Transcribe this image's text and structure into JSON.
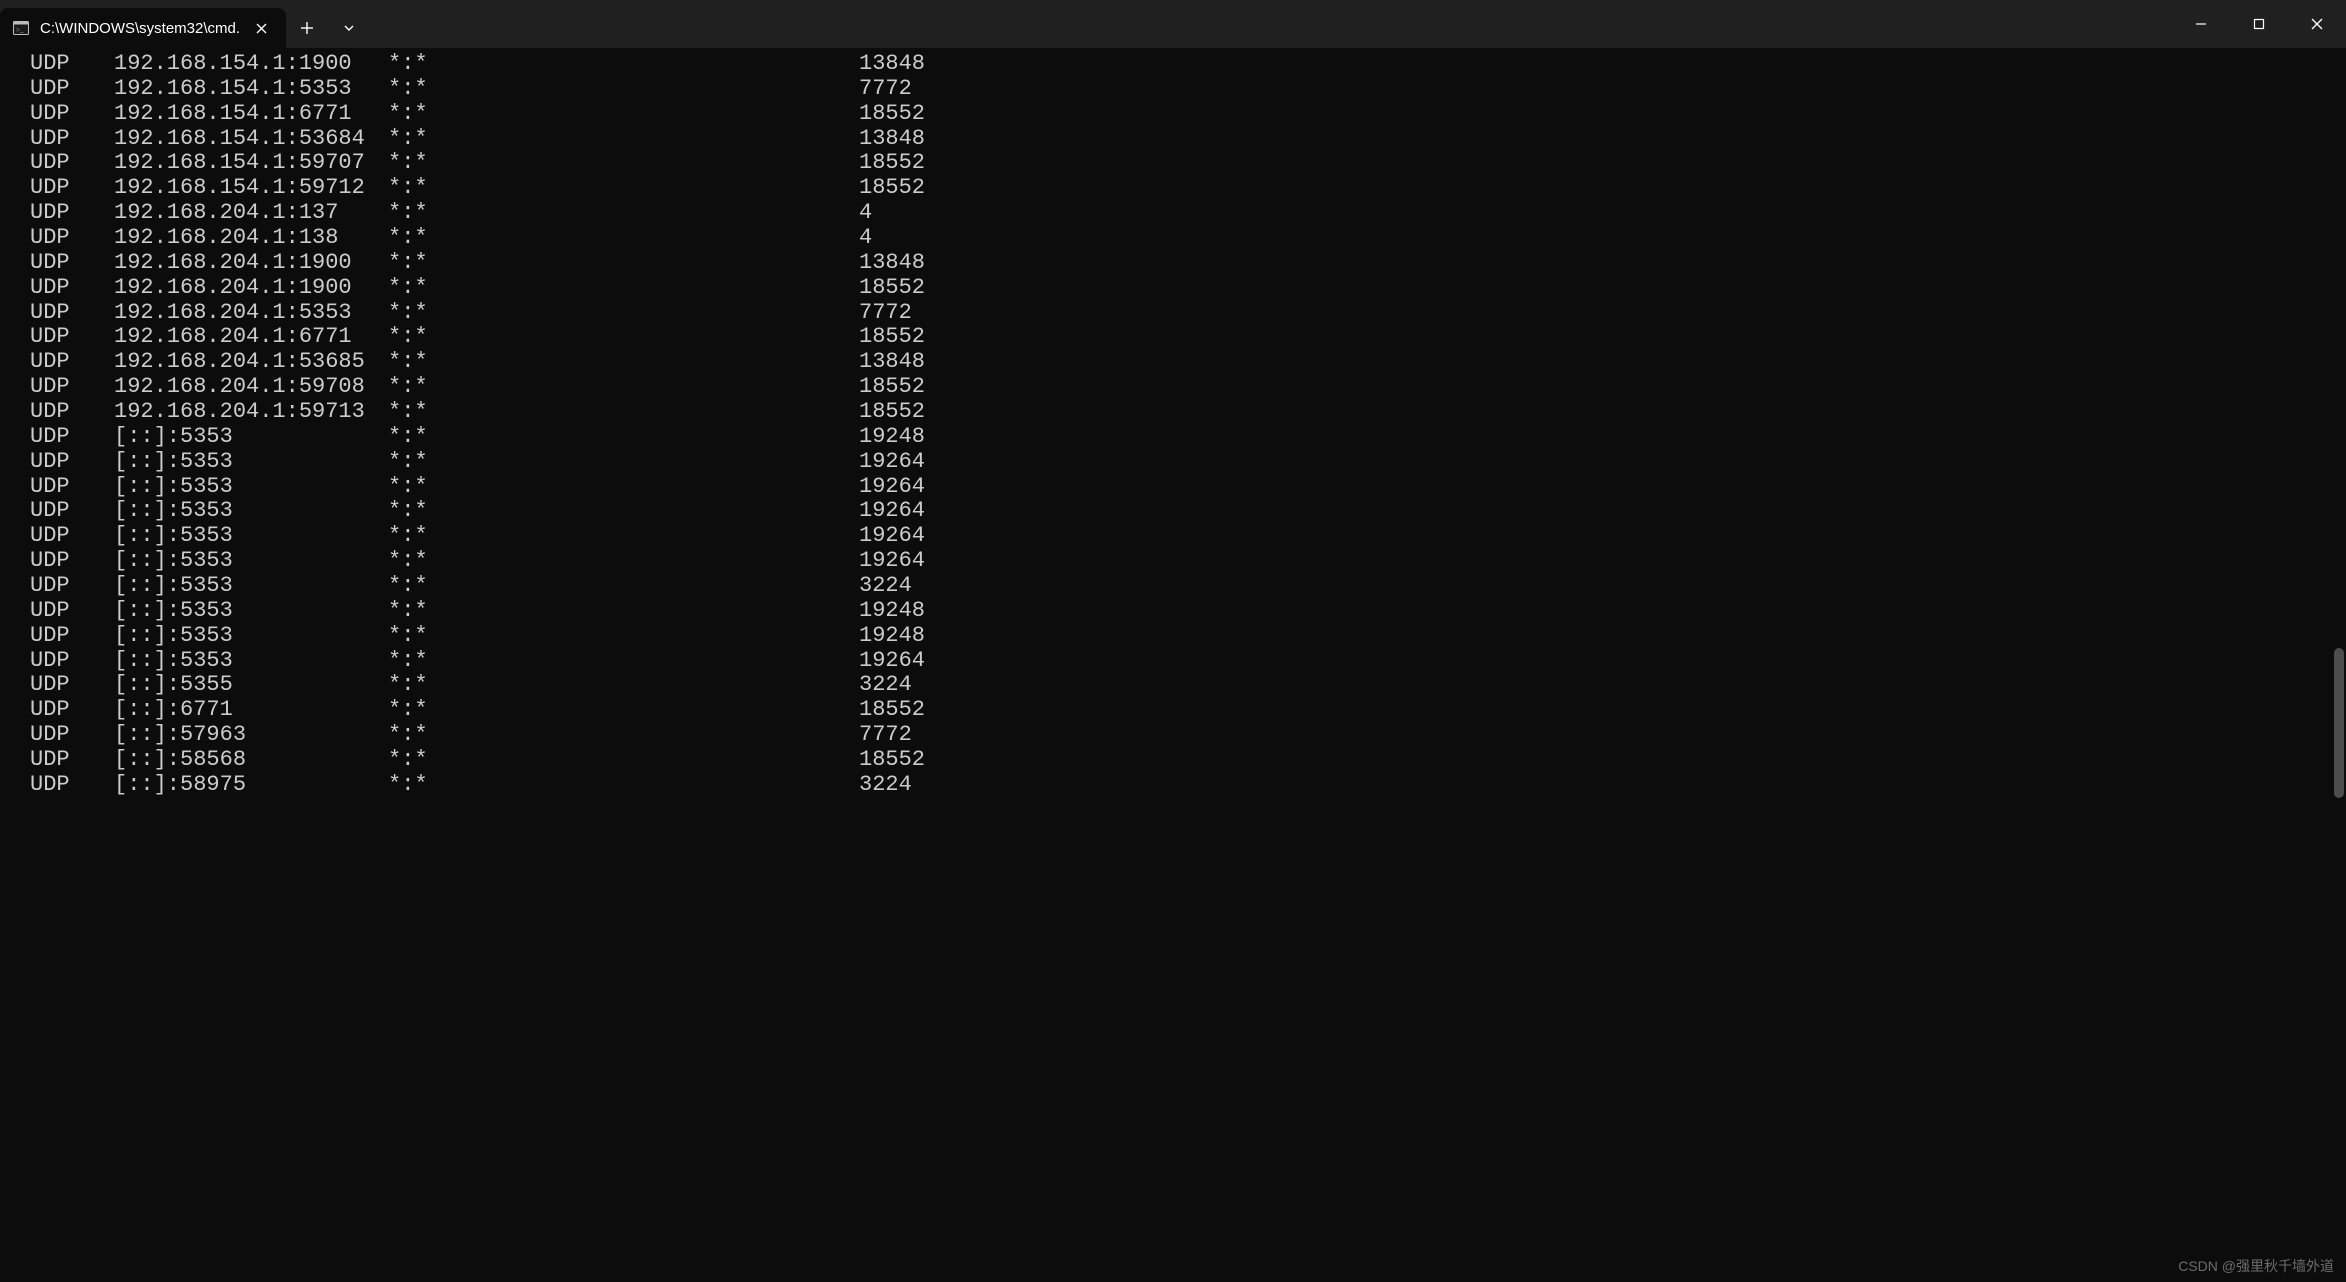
{
  "titlebar": {
    "tab_title": "C:\\WINDOWS\\system32\\cmd."
  },
  "watermark": "CSDN @强里秋千墙外道",
  "rows": [
    {
      "proto": "UDP",
      "local": "192.168.154.1:1900",
      "foreign": "*:*",
      "pid": "13848"
    },
    {
      "proto": "UDP",
      "local": "192.168.154.1:5353",
      "foreign": "*:*",
      "pid": "7772"
    },
    {
      "proto": "UDP",
      "local": "192.168.154.1:6771",
      "foreign": "*:*",
      "pid": "18552"
    },
    {
      "proto": "UDP",
      "local": "192.168.154.1:53684",
      "foreign": "*:*",
      "pid": "13848"
    },
    {
      "proto": "UDP",
      "local": "192.168.154.1:59707",
      "foreign": "*:*",
      "pid": "18552"
    },
    {
      "proto": "UDP",
      "local": "192.168.154.1:59712",
      "foreign": "*:*",
      "pid": "18552"
    },
    {
      "proto": "UDP",
      "local": "192.168.204.1:137",
      "foreign": "*:*",
      "pid": "4"
    },
    {
      "proto": "UDP",
      "local": "192.168.204.1:138",
      "foreign": "*:*",
      "pid": "4"
    },
    {
      "proto": "UDP",
      "local": "192.168.204.1:1900",
      "foreign": "*:*",
      "pid": "13848"
    },
    {
      "proto": "UDP",
      "local": "192.168.204.1:1900",
      "foreign": "*:*",
      "pid": "18552"
    },
    {
      "proto": "UDP",
      "local": "192.168.204.1:5353",
      "foreign": "*:*",
      "pid": "7772"
    },
    {
      "proto": "UDP",
      "local": "192.168.204.1:6771",
      "foreign": "*:*",
      "pid": "18552"
    },
    {
      "proto": "UDP",
      "local": "192.168.204.1:53685",
      "foreign": "*:*",
      "pid": "13848"
    },
    {
      "proto": "UDP",
      "local": "192.168.204.1:59708",
      "foreign": "*:*",
      "pid": "18552"
    },
    {
      "proto": "UDP",
      "local": "192.168.204.1:59713",
      "foreign": "*:*",
      "pid": "18552"
    },
    {
      "proto": "UDP",
      "local": "[::]:5353",
      "foreign": "*:*",
      "pid": "19248"
    },
    {
      "proto": "UDP",
      "local": "[::]:5353",
      "foreign": "*:*",
      "pid": "19264"
    },
    {
      "proto": "UDP",
      "local": "[::]:5353",
      "foreign": "*:*",
      "pid": "19264"
    },
    {
      "proto": "UDP",
      "local": "[::]:5353",
      "foreign": "*:*",
      "pid": "19264"
    },
    {
      "proto": "UDP",
      "local": "[::]:5353",
      "foreign": "*:*",
      "pid": "19264"
    },
    {
      "proto": "UDP",
      "local": "[::]:5353",
      "foreign": "*:*",
      "pid": "19264"
    },
    {
      "proto": "UDP",
      "local": "[::]:5353",
      "foreign": "*:*",
      "pid": "3224"
    },
    {
      "proto": "UDP",
      "local": "[::]:5353",
      "foreign": "*:*",
      "pid": "19248"
    },
    {
      "proto": "UDP",
      "local": "[::]:5353",
      "foreign": "*:*",
      "pid": "19248"
    },
    {
      "proto": "UDP",
      "local": "[::]:5353",
      "foreign": "*:*",
      "pid": "19264"
    },
    {
      "proto": "UDP",
      "local": "[::]:5355",
      "foreign": "*:*",
      "pid": "3224"
    },
    {
      "proto": "UDP",
      "local": "[::]:6771",
      "foreign": "*:*",
      "pid": "18552"
    },
    {
      "proto": "UDP",
      "local": "[::]:57963",
      "foreign": "*:*",
      "pid": "7772"
    },
    {
      "proto": "UDP",
      "local": "[::]:58568",
      "foreign": "*:*",
      "pid": "18552"
    },
    {
      "proto": "UDP",
      "local": "[::]:58975",
      "foreign": "*:*",
      "pid": "3224"
    }
  ]
}
